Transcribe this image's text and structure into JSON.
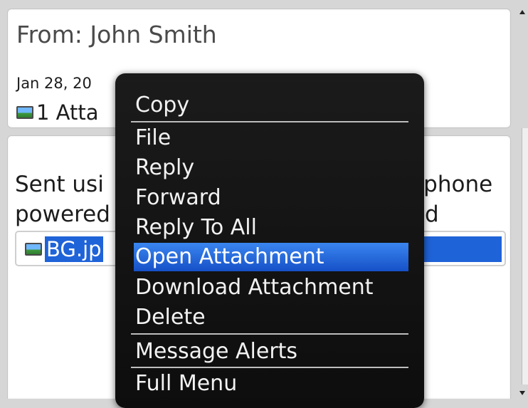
{
  "message": {
    "from_label": "From: John Smith",
    "date_visible": "Jan 28, 20",
    "attachment_count_visible": "1 Atta",
    "body_line1_left": "Sent usi",
    "body_line1_right": "tphone",
    "body_line2_left": "powered",
    "body_line2_right": "d",
    "attachment_name_visible": "BG.jp"
  },
  "menu": {
    "items": [
      {
        "label": "Copy"
      },
      {
        "label": "File"
      },
      {
        "label": "Reply"
      },
      {
        "label": "Forward"
      },
      {
        "label": "Reply To All"
      },
      {
        "label": "Open Attachment",
        "selected": true
      },
      {
        "label": "Download Attachment"
      },
      {
        "label": "Delete"
      },
      {
        "label": "Message Alerts"
      },
      {
        "label": "Full Menu"
      }
    ]
  },
  "colors": {
    "selection_blue": "#1f63d8",
    "menu_bg": "#121212",
    "menu_text": "#f2f2f2"
  },
  "icons": {
    "attachment": "image-icon"
  }
}
